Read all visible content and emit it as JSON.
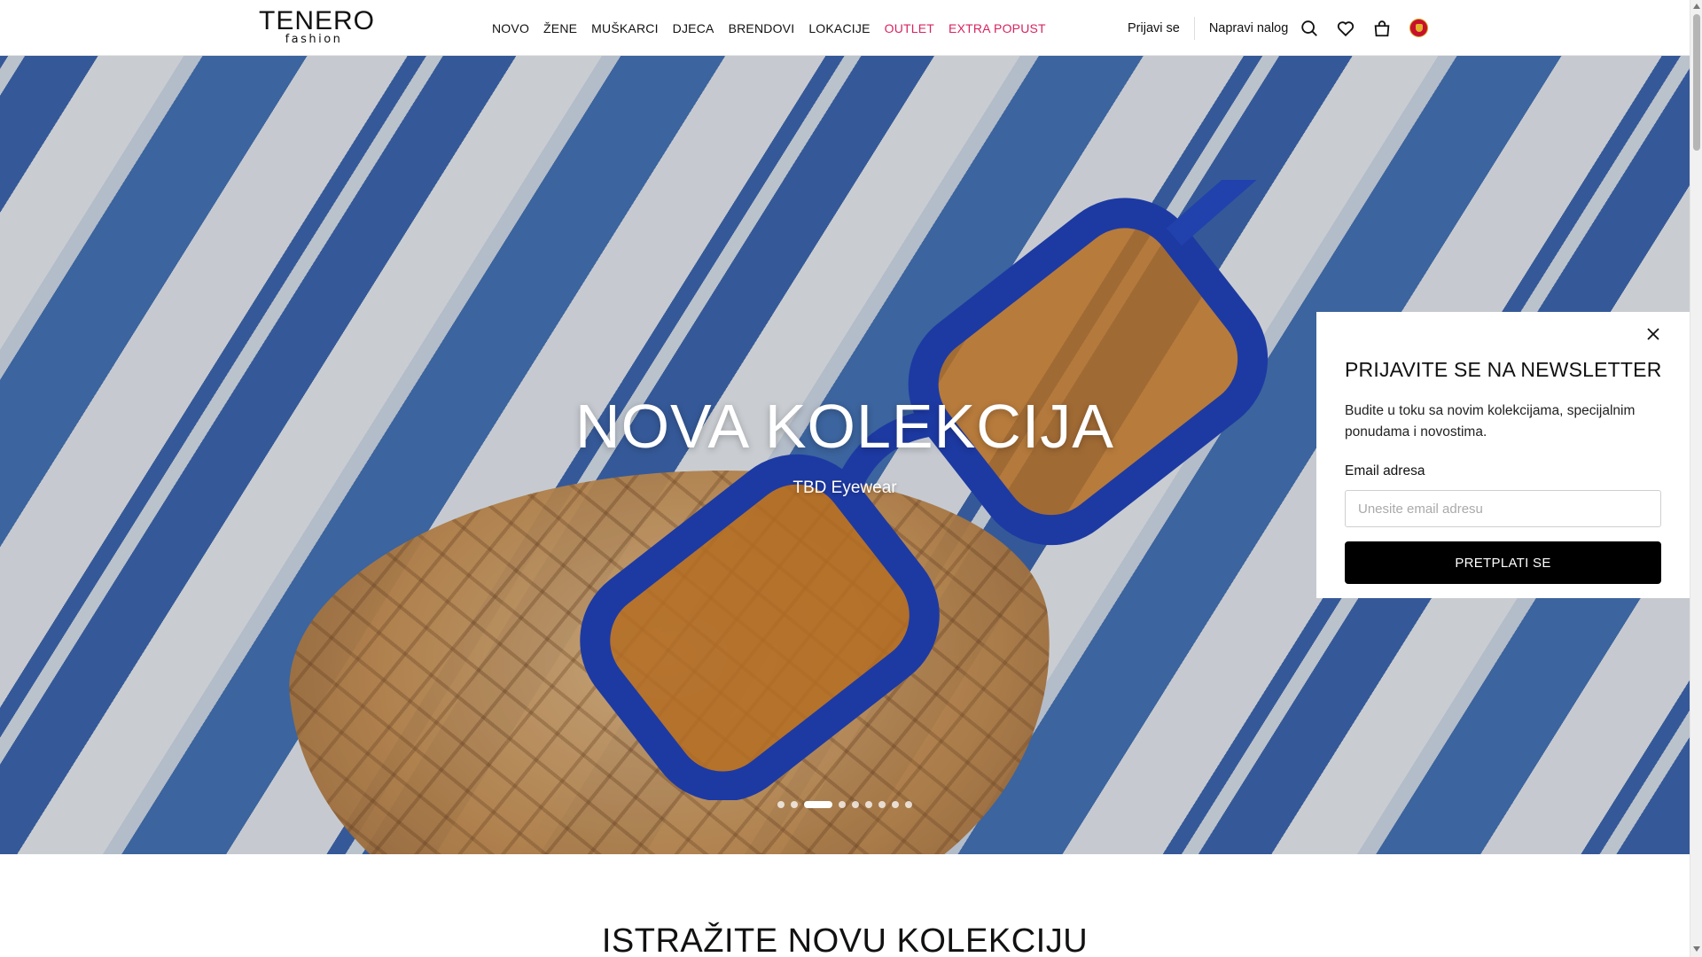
{
  "brand": {
    "name": "TENERO",
    "tagline": "fashion"
  },
  "nav": {
    "items": [
      {
        "label": "NOVO"
      },
      {
        "label": "ŽENE"
      },
      {
        "label": "MUŠKARCI"
      },
      {
        "label": "DJECA"
      },
      {
        "label": "BRENDOVI"
      },
      {
        "label": "LOKACIJE"
      },
      {
        "label": "OUTLET",
        "accent": true
      },
      {
        "label": "EXTRA POPUST",
        "accent": true
      }
    ],
    "accent_color": "#d6245f"
  },
  "account": {
    "login": "Prijavi se",
    "register": "Napravi nalog"
  },
  "header_icons": [
    "search-icon",
    "heart-icon",
    "shopping-bag-icon",
    "montenegro-flag-icon"
  ],
  "hero": {
    "title": "NOVA KOLEKCIJA",
    "subtitle": "TBD Eyewear",
    "slide_count": 9,
    "active_slide": 3
  },
  "newsletter": {
    "title": "PRIJAVITE SE NA NEWSLETTER",
    "text": "Budite u toku sa novim kolekcijama, specijalnim ponudama i novostima.",
    "email_label": "Email adresa",
    "email_placeholder": "Unesite email adresu",
    "email_value": "",
    "button_label": "PRETPLATI SE"
  },
  "section": {
    "title": "ISTRAŽITE NOVU KOLEKCIJU"
  }
}
